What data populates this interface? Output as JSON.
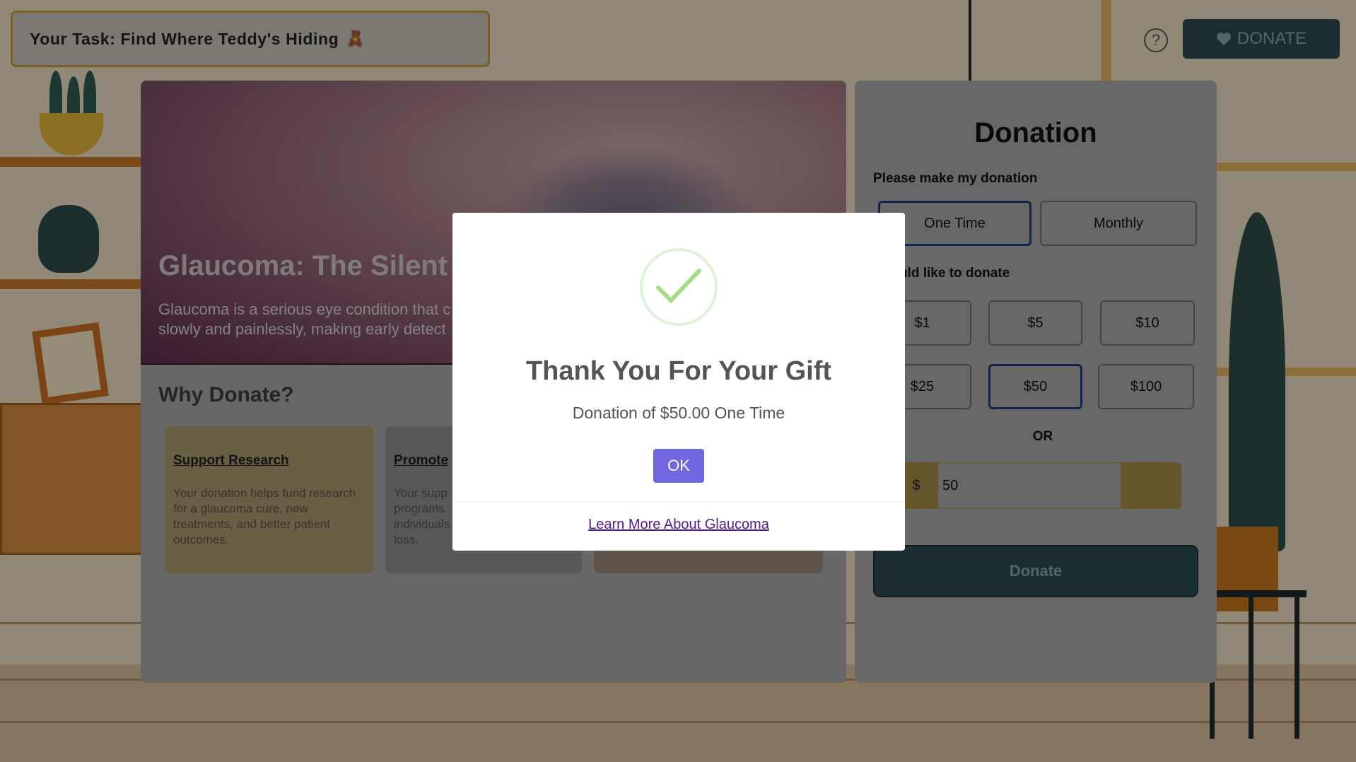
{
  "task": {
    "label": "Your Task: Find Where Teddy's Hiding",
    "emoji": "🧸"
  },
  "header": {
    "help_glyph": "?",
    "donate_button": "DONATE",
    "donate_icon": "heart-icon"
  },
  "info": {
    "hero_title": "Glaucoma: The Silent T",
    "hero_desc_line1": "Glaucoma is a serious eye condition that c",
    "hero_desc_line2": "slowly and painlessly, making early detect",
    "why_title": "Why Donate?",
    "reasons": [
      {
        "title": "Support Research",
        "text": "Your donation helps fund research for a glaucoma cure, new treatments, and better patient outcomes.",
        "color": "#a8996f"
      },
      {
        "title": "Promote ",
        "text": "Your supp programs individuals loss.",
        "color": "#8e8e8e"
      },
      {
        "title": "",
        "text": "",
        "color": "#9a8577"
      }
    ]
  },
  "donation": {
    "heading": "Donation",
    "frequency_label": "Please make my donation",
    "frequency_options": [
      "One Time",
      "Monthly"
    ],
    "frequency_selected": "One Time",
    "amount_label": "I would like to donate",
    "amount_label_visible": "uld like to donate",
    "amounts": [
      "$1",
      "$5",
      "$10",
      "$25",
      "$50",
      "$100"
    ],
    "amount_selected": "$50",
    "or_label": "OR",
    "currency_symbol": "$",
    "custom_amount": "50",
    "submit_label": "Donate"
  },
  "modal": {
    "title": "Thank You For Your Gift",
    "message": "Donation of $50.00 One Time",
    "ok_label": "OK",
    "link_label": "Learn More About Glaucoma",
    "success_color": "#a5dc86",
    "button_color": "#7066e0"
  }
}
